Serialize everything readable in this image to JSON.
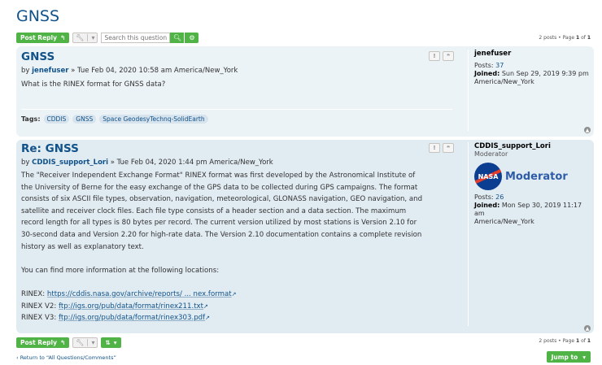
{
  "page": {
    "title": "GNSS"
  },
  "toolbar_top": {
    "post_reply": "Post Reply",
    "search_placeholder": "Search this question...",
    "pagination": "2 posts • Page ",
    "page_current": "1",
    "page_of": " of ",
    "page_total": "1"
  },
  "posts": [
    {
      "title": "GNSS",
      "by": "by ",
      "author": "jenefuser",
      "date": " » Tue Feb 04, 2020 10:58 am America/New_York",
      "body": "What is the RINEX format for GNSS data?",
      "tags_label": "Tags:",
      "tags": [
        "CDDIS",
        "GNSS",
        "Space GeodesyTechnq-SolidEarth"
      ],
      "profile": {
        "name": "jenefuser",
        "posts_label": "Posts:",
        "posts": "37",
        "joined_label": "Joined:",
        "joined": "Sun Sep 29, 2019 9:39 pm",
        "tz": "America/New_York"
      }
    },
    {
      "title": "Re: GNSS",
      "by": "by ",
      "author": "CDDIS_support_Lori",
      "date": " » Tue Feb 04, 2020 1:44 pm America/New_York",
      "body_lines": [
        "The \"Receiver Independent Exchange Format\" RINEX format was first developed by the Astronomical Institute of",
        "the University of Berne for the easy exchange of the GPS data to be collected during GPS campaigns. The format",
        "consists of six ASCII file types, observation, navigation, meteorological, GLONASS navigation, GEO navigation, and",
        "satellite and receiver clock files. Each file type consists of a header section and a data section. The maximum",
        "record length for all types is 80 bytes per record. The current version utilized by most stations is Version 2.10 for",
        "30-second data and Version 2.20 for high-rate data. The Version 2.10 documentation contains a complete revision",
        "history as well as explanatory text."
      ],
      "more_info": "You can find more information at the following locations:",
      "links": [
        {
          "label": "RINEX: ",
          "url": "https://cddis.nasa.gov/archive/reports/ ... nex.format"
        },
        {
          "label": "RINEX V2: ",
          "url": "ftp://igs.org/pub/data/format/rinex211.txt"
        },
        {
          "label": "RINEX V3: ",
          "url": "ftp://igs.org/pub/data/format/rinex303.pdf"
        }
      ],
      "profile": {
        "name": "CDDIS_support_Lori",
        "rank": "Moderator",
        "logo_text": "NASA",
        "logo_caption": "Moderator",
        "posts_label": "Posts:",
        "posts": "26",
        "joined_label": "Joined:",
        "joined": "Mon Sep 30, 2019 11:17 am",
        "tz": "America/New_York"
      }
    }
  ],
  "toolbar_bottom": {
    "post_reply": "Post Reply",
    "pagination": "2 posts • Page ",
    "page_current": "1",
    "page_of": " of ",
    "page_total": "1"
  },
  "footer": {
    "return_link": "Return to “All Questions/Comments”",
    "jump_to": "Jump to"
  },
  "icons": {
    "report": "!",
    "quote": "❝"
  },
  "colors": {
    "accent_blue": "#105289",
    "green": "#4fb345",
    "post_bg1": "#e1ebf2",
    "post_bg2": "#ecf3f7"
  }
}
